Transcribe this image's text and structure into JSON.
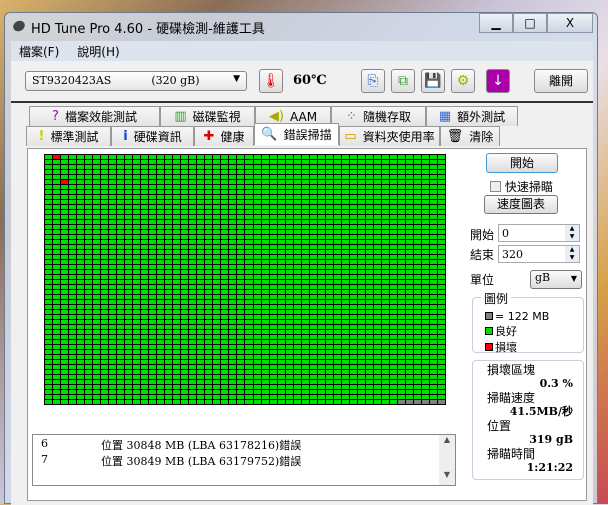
{
  "window": {
    "title": "HD Tune Pro 4.60 - 硬碟檢測-維護工具",
    "minimize": "▁",
    "maximize": "□",
    "close": "X"
  },
  "menu": [
    "檔案(F)",
    "說明(H)"
  ],
  "toolbar": {
    "drive_name": "ST9320423AS",
    "drive_capacity": "(320 gB)",
    "temperature": "60℃",
    "exit": "離開"
  },
  "tabs_top": [
    {
      "label": "檔案效能測試",
      "icon": "?"
    },
    {
      "label": "磁碟監視",
      "icon": "▥"
    },
    {
      "label": "AAM",
      "icon": "◀)"
    },
    {
      "label": "隨機存取",
      "icon": "⁘"
    },
    {
      "label": "額外測試",
      "icon": "▦"
    }
  ],
  "tabs_bottom": [
    {
      "label": "標準測試",
      "icon": "!"
    },
    {
      "label": "硬碟資訊",
      "icon": "i"
    },
    {
      "label": "健康",
      "icon": "✚"
    },
    {
      "label": "錯誤掃描",
      "icon": "🔍"
    },
    {
      "label": "資料夾使用率",
      "icon": "▭"
    },
    {
      "label": "清除",
      "icon": "🗑"
    }
  ],
  "active_tab": "錯誤掃描",
  "scan": {
    "start_button": "開始",
    "quick_scan": "快速掃瞄",
    "quick_scan_checked": false,
    "speed_chart": "速度圖表",
    "start_label": "開始",
    "start_value": "0",
    "end_label": "結束",
    "end_value": "320",
    "unit_label": "單位",
    "unit_value": "gB"
  },
  "legend": {
    "title": "圖例",
    "block": "= 122 MB",
    "good": "良好",
    "bad": "損壞"
  },
  "stats": {
    "damaged_label": "損壞區塊",
    "damaged_value": "0.3 %",
    "speed_label": "掃瞄速度",
    "speed_value": "41.5MB/秒",
    "position_label": "位置",
    "position_value": "319 gB",
    "time_label": "掃瞄時間",
    "time_value": "1:21:22"
  },
  "log": [
    {
      "n": "6",
      "text": "位置 30848 MB (LBA 63178216)錯誤"
    },
    {
      "n": "7",
      "text": "位置 30849 MB (LBA 63179752)錯誤"
    }
  ],
  "grid": {
    "columns": 50,
    "rows": 50,
    "bad_cells": [
      [
        0,
        1
      ],
      [
        5,
        2
      ]
    ],
    "unscanned_count": 6
  },
  "colors": {
    "good": "#00e000",
    "bad": "#ff0000",
    "unscanned": "#808080"
  }
}
